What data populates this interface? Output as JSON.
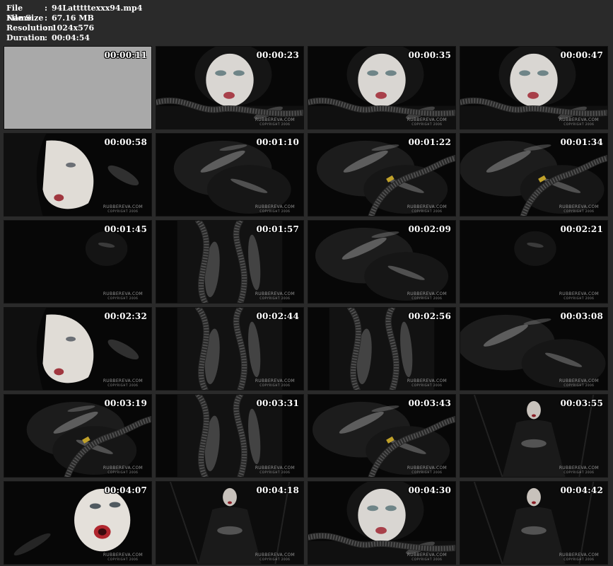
{
  "file_info": {
    "name_label": "File Name",
    "name_value": "94Latttttexxx94.mp4",
    "size_label": "File Size",
    "size_value": "67.16 MB",
    "resolution_label": "Resolution",
    "resolution_value": "1024x576",
    "duration_label": "Duration",
    "duration_value": "00:04:54",
    "separator": ":"
  },
  "watermark": {
    "site": "RUBBEREVA.COM",
    "copyright": "COPYRIGHT 2006"
  },
  "thumbnails": [
    {
      "time": "00:00:11",
      "scene": "blank"
    },
    {
      "time": "00:00:23",
      "scene": "face-hose"
    },
    {
      "time": "00:00:35",
      "scene": "face-mask"
    },
    {
      "time": "00:00:47",
      "scene": "face-mask"
    },
    {
      "time": "00:00:58",
      "scene": "face-side"
    },
    {
      "time": "00:01:10",
      "scene": "latex-body"
    },
    {
      "time": "00:01:22",
      "scene": "gloves-hose"
    },
    {
      "time": "00:01:34",
      "scene": "gloves-hose"
    },
    {
      "time": "00:01:45",
      "scene": "dark"
    },
    {
      "time": "00:01:57",
      "scene": "hose-body"
    },
    {
      "time": "00:02:09",
      "scene": "latex-body"
    },
    {
      "time": "00:02:21",
      "scene": "dark"
    },
    {
      "time": "00:02:32",
      "scene": "face-side"
    },
    {
      "time": "00:02:44",
      "scene": "hose-body"
    },
    {
      "time": "00:02:56",
      "scene": "hose-body"
    },
    {
      "time": "00:03:08",
      "scene": "latex-body"
    },
    {
      "time": "00:03:19",
      "scene": "gloves-hose"
    },
    {
      "time": "00:03:31",
      "scene": "hose-body"
    },
    {
      "time": "00:03:43",
      "scene": "gloves-hose"
    },
    {
      "time": "00:03:55",
      "scene": "figure-dark"
    },
    {
      "time": "00:04:07",
      "scene": "mask-lips"
    },
    {
      "time": "00:04:18",
      "scene": "figure-dark"
    },
    {
      "time": "00:04:30",
      "scene": "face-mask"
    },
    {
      "time": "00:04:42",
      "scene": "figure-dark"
    }
  ]
}
